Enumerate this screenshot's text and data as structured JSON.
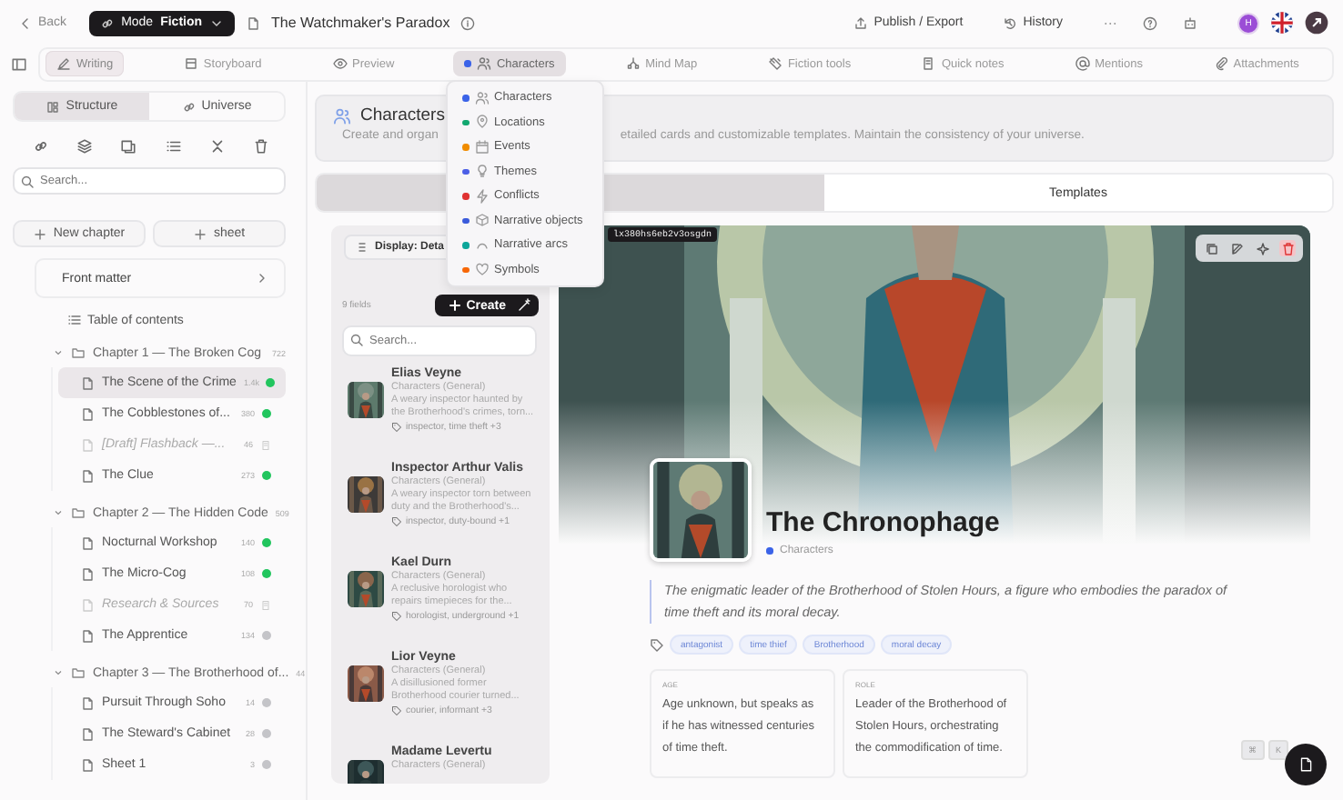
{
  "topbar": {
    "back": "Back",
    "mode_label": "Mode",
    "mode_value": "Fiction",
    "title": "The Watchmaker's Paradox",
    "actions": [
      {
        "kind": "publish",
        "label": "Publish / Export"
      },
      {
        "kind": "history",
        "label": "History"
      }
    ],
    "avatar_initial": "H"
  },
  "tabs": [
    {
      "kind": "writing",
      "label": "Writing",
      "selected": true,
      "expanded": false
    },
    {
      "kind": "board",
      "label": "Storyboard",
      "selected": false,
      "expanded": false
    },
    {
      "kind": "eye",
      "label": "Preview",
      "selected": false,
      "expanded": false
    },
    {
      "kind": "users",
      "label": "Characters",
      "selected": false,
      "expanded": true
    },
    {
      "kind": "tree",
      "label": "Mind Map",
      "selected": false,
      "expanded": false
    },
    {
      "kind": "tools",
      "label": "Fiction tools",
      "selected": false,
      "expanded": false
    },
    {
      "kind": "note",
      "label": "Quick notes",
      "selected": false,
      "expanded": false
    },
    {
      "kind": "at",
      "label": "Mentions",
      "selected": false,
      "expanded": false
    },
    {
      "kind": "clip",
      "label": "Attachments",
      "selected": false,
      "expanded": false
    }
  ],
  "dropdown": [
    {
      "kind": "users",
      "label": "Characters",
      "color": "#3b63e8"
    },
    {
      "kind": "pin",
      "label": "Locations",
      "color": "#12a870"
    },
    {
      "kind": "calendar",
      "label": "Events",
      "color": "#f08c00"
    },
    {
      "kind": "bulb",
      "label": "Themes",
      "color": "#4c5fe6"
    },
    {
      "kind": "bolt",
      "label": "Conflicts",
      "color": "#e03131"
    },
    {
      "kind": "box",
      "label": "Narrative objects",
      "color": "#3b5bdb"
    },
    {
      "kind": "arc",
      "label": "Narrative arcs",
      "color": "#0ca69a"
    },
    {
      "kind": "heart",
      "label": "Symbols",
      "color": "#f76707"
    }
  ],
  "sidebar": {
    "modes": [
      {
        "kind": "structure",
        "label": "Structure",
        "selected": true
      },
      {
        "kind": "link",
        "label": "Universe",
        "selected": false
      }
    ],
    "search": {
      "placeholder": "Search..."
    },
    "buttons": [
      "New chapter",
      "sheet"
    ],
    "front_matter": "Front matter",
    "toc": "Table of contents",
    "tree": [
      {
        "label": "Chapter 1 — The Broken Cog",
        "count": "722",
        "expanded": true,
        "children": [
          {
            "kind": "sheet",
            "label": "The Scene of the Crime",
            "count": "1.4k",
            "done": true,
            "selected": true
          },
          {
            "kind": "sheet",
            "label": "The Cobblestones of...",
            "count": "380",
            "done": true,
            "selected": false
          },
          {
            "kind": "draft",
            "label": "[Draft] Flashback —...",
            "count": "46",
            "selected": false
          },
          {
            "kind": "sheet",
            "label": "The Clue",
            "count": "273",
            "done": true,
            "selected": false
          }
        ]
      },
      {
        "label": "Chapter 2 — The Hidden Code",
        "count": "509",
        "expanded": true,
        "children": [
          {
            "kind": "sheet",
            "label": "Nocturnal Workshop",
            "count": "140",
            "done": true,
            "selected": false
          },
          {
            "kind": "sheet",
            "label": "The Micro-Cog",
            "count": "108",
            "done": true,
            "selected": false
          },
          {
            "kind": "draft",
            "label": "Research & Sources",
            "count": "70",
            "selected": false
          },
          {
            "kind": "sheet",
            "label": "The Apprentice",
            "count": "134",
            "done": false,
            "selected": false
          }
        ]
      },
      {
        "label": "Chapter 3 — The Brotherhood of...",
        "count": "44",
        "expanded": true,
        "children": [
          {
            "kind": "sheet",
            "label": "Pursuit Through Soho",
            "count": "14",
            "done": false,
            "selected": false
          },
          {
            "kind": "sheet",
            "label": "The Steward's Cabinet",
            "count": "28",
            "done": false,
            "selected": false
          },
          {
            "kind": "sheet",
            "label": "Sheet 1",
            "count": "3",
            "done": false,
            "selected": false
          }
        ]
      }
    ]
  },
  "header": {
    "title": "Characters",
    "description_start": "Create and organ",
    "description_end": "etailed cards and customizable templates. Maintain the consistency of your universe."
  },
  "view_tabs": [
    {
      "selected": true
    },
    {
      "label": "Templates",
      "selected": false
    }
  ],
  "list": {
    "display": "Display: Deta",
    "count": "9 fields",
    "create": "Create",
    "search": {
      "placeholder": "Search..."
    },
    "items": [
      {
        "name": "Elias Veyne",
        "category": "Characters (General)",
        "description": "A weary inspector haunted by the Brotherhood's crimes, torn...",
        "tags": "inspector, time theft +3"
      },
      {
        "name": "Inspector Arthur Valis",
        "category": "Characters (General)",
        "description": "A weary inspector torn between duty and the Brotherhood's...",
        "tags": "inspector, duty-bound +1"
      },
      {
        "name": "Kael Durn",
        "category": "Characters (General)",
        "description": "A reclusive horologist who repairs timepieces for the...",
        "tags": "horologist, underground +1"
      },
      {
        "name": "Lior Veyne",
        "category": "Characters (General)",
        "description": "A disillusioned former Brotherhood courier turned...",
        "tags": "courier, informant +3"
      },
      {
        "name": "Madame Levertu",
        "category": "Characters (General)"
      }
    ]
  },
  "detail": {
    "image_id": "lx380hs6eb2v3osgdn",
    "name": "The Chronophage",
    "category": "Characters",
    "summary": "The enigmatic leader of the Brotherhood of Stolen Hours, a figure who embodies the paradox of time theft and its moral decay.",
    "tags": [
      "antagonist",
      "time thief",
      "Brotherhood",
      "moral decay"
    ],
    "fields": [
      {
        "label": "AGE",
        "value": "Age unknown, but speaks as if he has witnessed centuries of time theft."
      },
      {
        "label": "ROLE",
        "value": "Leader of the Brotherhood of Stolen Hours, orchestrating the commodification of time."
      }
    ]
  },
  "shortcut": [
    "⌘",
    "K"
  ]
}
